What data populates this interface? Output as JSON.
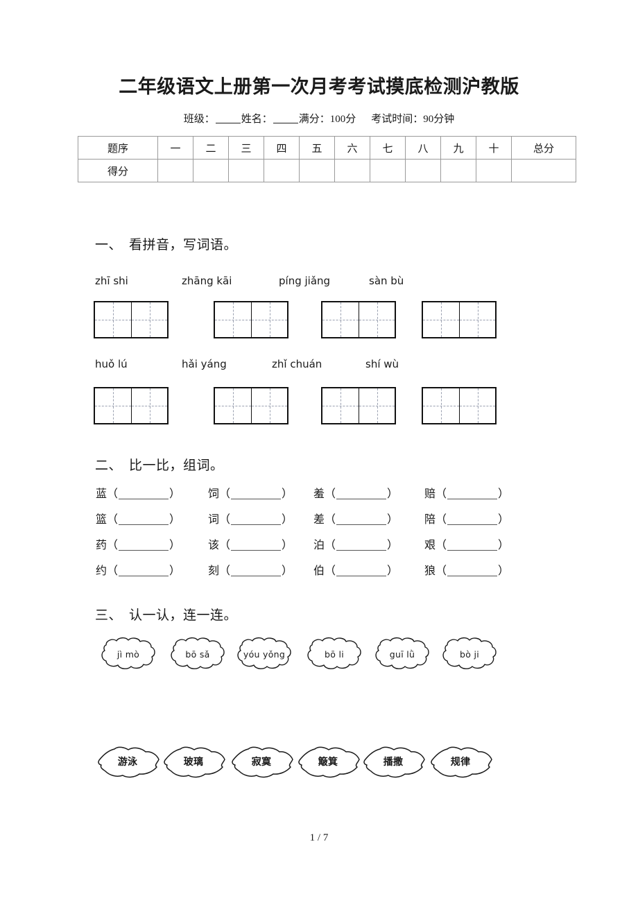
{
  "document": {
    "title": "二年级语文上册第一次月考考试摸底检测沪教版",
    "subtitle": {
      "class_label": "班级：",
      "name_label": "姓名：",
      "full_marks": "满分：100分",
      "exam_time": "考试时间：90分钟"
    },
    "footer": "1 / 7"
  },
  "score_table": {
    "rows": [
      {
        "label": "题序",
        "cells": [
          "一",
          "二",
          "三",
          "四",
          "五",
          "六",
          "七",
          "八",
          "九",
          "十",
          "总分"
        ]
      },
      {
        "label": "得分",
        "cells": [
          "",
          "",
          "",
          "",
          "",
          "",
          "",
          "",
          "",
          "",
          ""
        ]
      }
    ]
  },
  "sections": [
    {
      "index": "一、",
      "title": "看拼音，写词语。",
      "rows": [
        {
          "pinyin": [
            "zhī  shi",
            "zhāng kāi",
            "píng jiǎng",
            "sàn  bù"
          ]
        },
        {
          "pinyin": [
            "huǒ   lú",
            "hǎi yáng",
            "zhǐ chuán",
            "shí wù"
          ]
        }
      ]
    },
    {
      "index": "二、",
      "title": "比一比，组词。",
      "rows": [
        [
          "蓝",
          "饲",
          "羞",
          "赔"
        ],
        [
          "篮",
          "词",
          "差",
          "陪"
        ],
        [
          "药",
          "该",
          "泊",
          "艰"
        ],
        [
          "约",
          "刻",
          "伯",
          "狼"
        ]
      ]
    },
    {
      "index": "三、",
      "title": "认一认，连一连。",
      "clouds": [
        "jì mò",
        "bō sǎ",
        "yóu yǒng",
        "bō li",
        "guī lǜ",
        "bò ji"
      ],
      "leaves": [
        "游泳",
        "玻璃",
        "寂寞",
        "簸箕",
        "播撒",
        "规律"
      ]
    }
  ]
}
